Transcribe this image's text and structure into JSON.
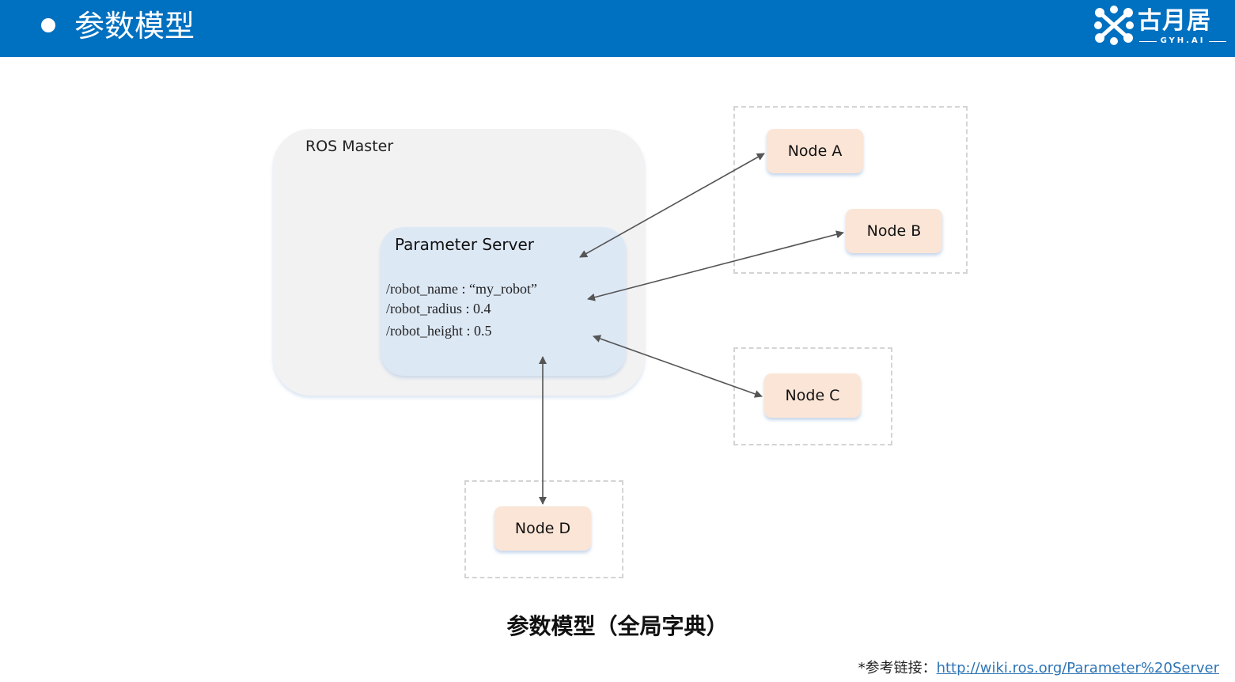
{
  "header": {
    "title": "参数模型",
    "logo_text": "古月居",
    "logo_sub": "GYH.AI"
  },
  "colors": {
    "header_bg": "#0070c0",
    "master_bg": "#f2f2f2",
    "server_bg": "#dde8f5",
    "node_bg": "#fbe5d6",
    "arrow": "#555555",
    "link": "#2e75b6"
  },
  "diagram": {
    "master_label": "ROS Master",
    "server_label": "Parameter Server",
    "params": [
      "/robot_name : “my_robot”",
      "/robot_radius : 0.4",
      "/robot_height : 0.5"
    ],
    "nodes": [
      "Node A",
      "Node B",
      "Node C",
      "Node D"
    ]
  },
  "caption": "参数模型（全局字典）",
  "reference": {
    "prefix": "*参考链接：",
    "link": "http://wiki.ros.org/Parameter%20Server"
  }
}
